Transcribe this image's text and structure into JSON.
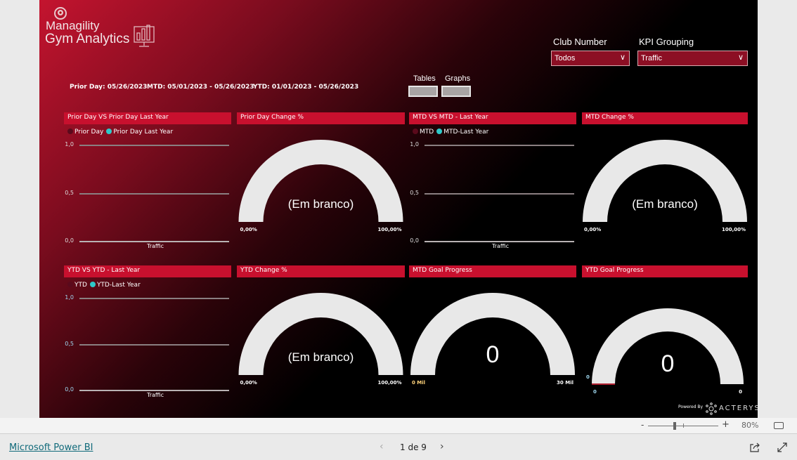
{
  "header": {
    "brand_line1": "Managility",
    "brand_line2": "Gym Analytics"
  },
  "dates": {
    "prior_day": "Prior Day: 05/26/2023",
    "mtd": "MTD: 05/01/2023 - 05/26/2023",
    "ytd": "YTD: 01/01/2023 - 05/26/2023"
  },
  "slicers": {
    "club_number": {
      "label": "Club Number",
      "value": "Todos"
    },
    "kpi_grouping": {
      "label": "KPI Grouping",
      "value": "Traffic"
    }
  },
  "toggles": {
    "tables": "Tables",
    "graphs": "Graphs"
  },
  "colors": {
    "accent": "#c8102e",
    "series_dark": "#5a0a1c",
    "series_cyan": "#2ec9c9",
    "gauge": "#e8e8e8"
  },
  "panels": {
    "p1": {
      "title": "Prior Day VS Prior Day Last Year",
      "legend": [
        "Prior Day",
        "Prior Day Last Year"
      ],
      "yticks": [
        "1,0",
        "0,5",
        "0,0"
      ],
      "xlabel": "Traffic"
    },
    "p2": {
      "title": "Prior Day Change %",
      "center": "(Em branco)",
      "min": "0,00%",
      "max": "100,00%"
    },
    "p3": {
      "title": "MTD VS MTD - Last Year",
      "legend": [
        "MTD",
        "MTD-Last Year"
      ],
      "yticks": [
        "1,0",
        "0,5",
        "0,0"
      ],
      "xlabel": "Traffic"
    },
    "p4": {
      "title": "MTD Change %",
      "center": "(Em branco)",
      "min": "0,00%",
      "max": "100,00%"
    },
    "p5": {
      "title": "YTD VS YTD - Last Year",
      "legend": [
        "YTD",
        "YTD-Last Year"
      ],
      "yticks": [
        "1,0",
        "0,5",
        "0,0"
      ],
      "xlabel": "Traffic"
    },
    "p6": {
      "title": "YTD Change %",
      "center": "(Em branco)",
      "min": "0,00%",
      "max": "100,00%"
    },
    "p7": {
      "title": "MTD Goal Progress",
      "center": "0",
      "min": "0 Mil",
      "max": "30 Mil"
    },
    "p8": {
      "title": "YTD Goal Progress",
      "center": "0",
      "min": "0",
      "max": "0",
      "target": "0"
    }
  },
  "powered_by": {
    "label": "Powered By",
    "brand": "ACTERYS"
  },
  "zoom": {
    "minus": "-",
    "plus": "+",
    "level": "80%"
  },
  "footer": {
    "link": "Microsoft Power BI",
    "page": "1 de 9"
  }
}
